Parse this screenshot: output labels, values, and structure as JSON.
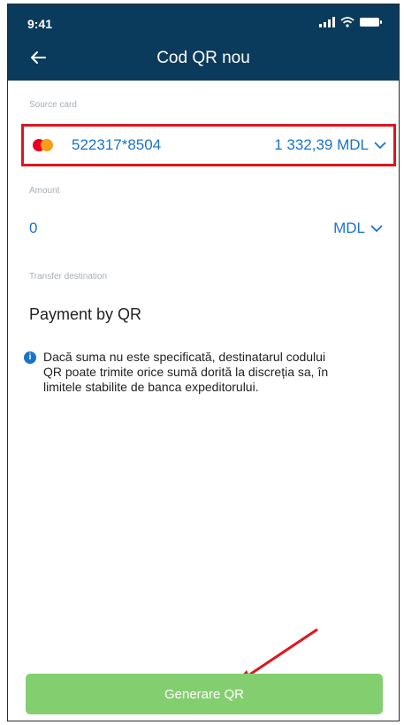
{
  "status_bar": {
    "time": "9:41"
  },
  "header": {
    "title": "Cod QR nou",
    "back_icon": "back-arrow-icon"
  },
  "source_card": {
    "label": "Source card",
    "number": "522317*8504",
    "balance": "1 332,39 MDL",
    "icon": "mastercard-icon"
  },
  "amount": {
    "label": "Amount",
    "value": "0",
    "currency": "MDL"
  },
  "transfer_destination": {
    "label": "Transfer destination",
    "value": "Payment by QR"
  },
  "info": {
    "text": "Dacă suma nu este specificată, destinatarul codului QR poate trimite  orice sumă dorită la discreția sa, în limitele stabilite de banca expeditorului."
  },
  "actions": {
    "generate_label": "Generare QR"
  },
  "colors": {
    "header_bg": "#0b3b5c",
    "accent": "#1a73c9",
    "highlight": "#e0141e",
    "button_bg": "#83cf6f"
  }
}
